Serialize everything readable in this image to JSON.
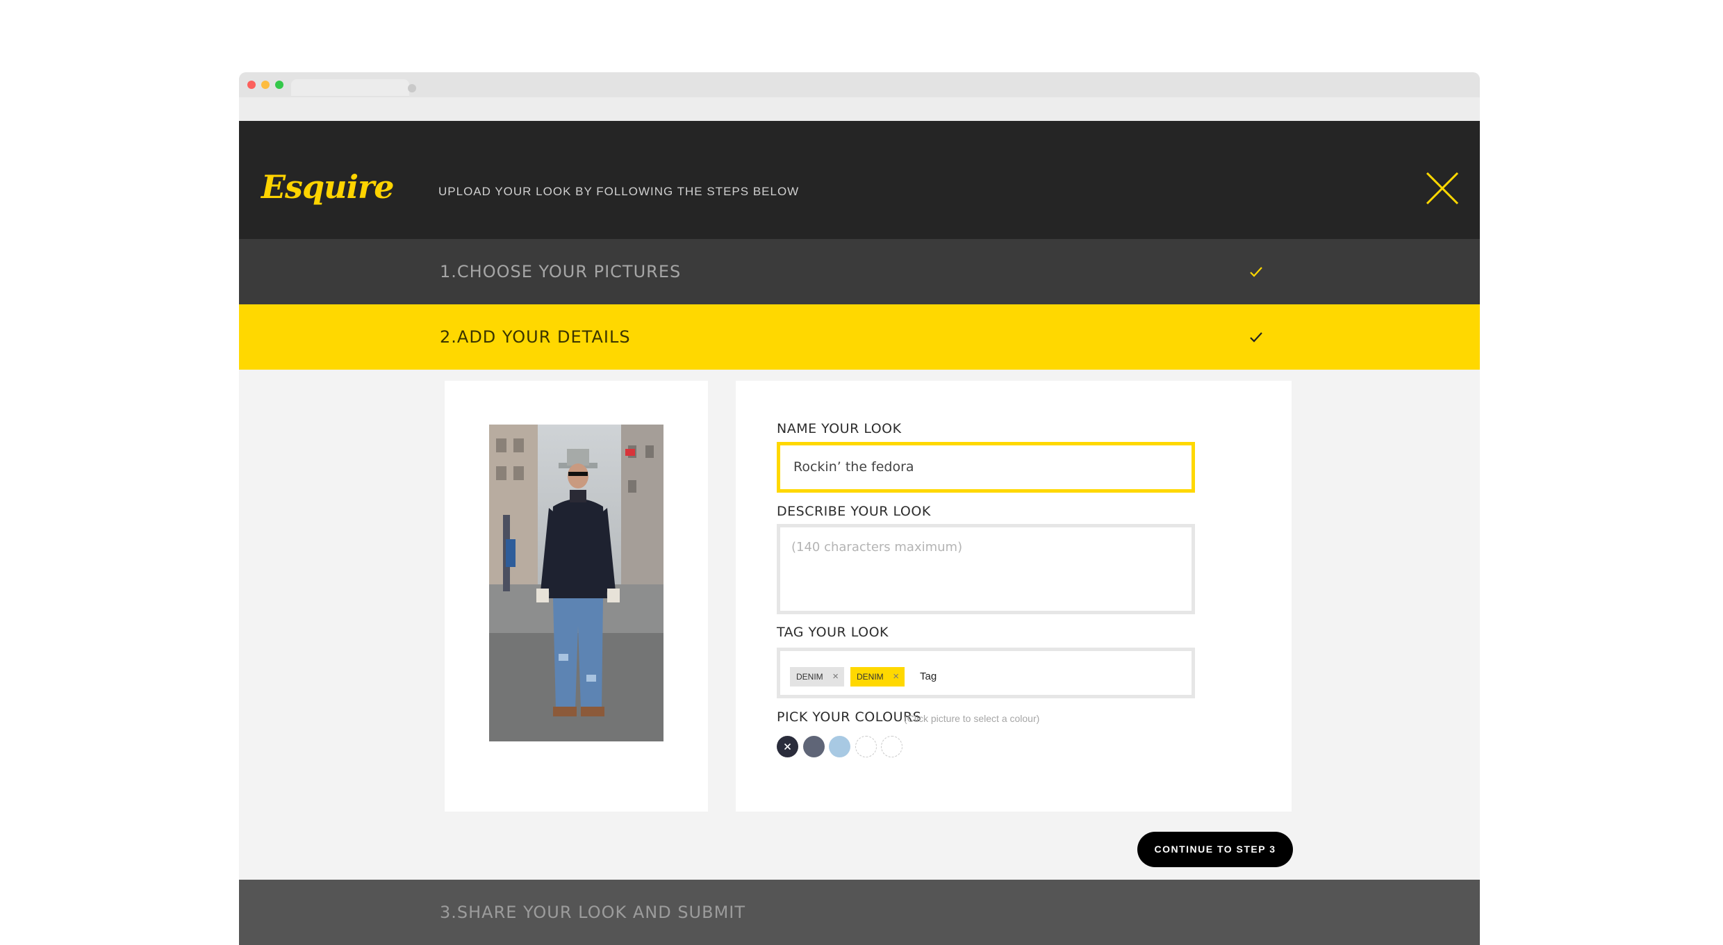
{
  "header": {
    "logo_text": "Esquire",
    "subtitle": "UPLOAD YOUR LOOK BY FOLLOWING THE STEPS BELOW",
    "close_icon": "close-icon"
  },
  "steps": [
    {
      "label": "1.CHOOSE YOUR PICTURES",
      "completed": true
    },
    {
      "label": "2.ADD YOUR DETAILS",
      "completed": true,
      "active": true
    },
    {
      "label": "3.SHARE YOUR LOOK AND SUBMIT",
      "completed": false
    }
  ],
  "form": {
    "name_label": "NAME YOUR LOOK",
    "name_value": "Rockin’ the fedora",
    "describe_label": "DESCRIBE YOUR LOOK",
    "describe_placeholder": "(140 characters maximum)",
    "tag_label": "TAG YOUR LOOK",
    "tags": [
      "DENIM",
      "DENIM"
    ],
    "tag_input_value": "Tag",
    "colours_label": "PICK YOUR COLOURS",
    "colours_hint": "(Click picture to select a colour)",
    "colours": [
      "#2a2c3b",
      "#5f6577",
      "#a8c9e3",
      "",
      ""
    ]
  },
  "actions": {
    "continue_label": "CONTINUE TO STEP 3"
  },
  "colors": {
    "accent": "#ffd800",
    "header_bg": "#252525",
    "step_bg": "#3b3b3b"
  }
}
